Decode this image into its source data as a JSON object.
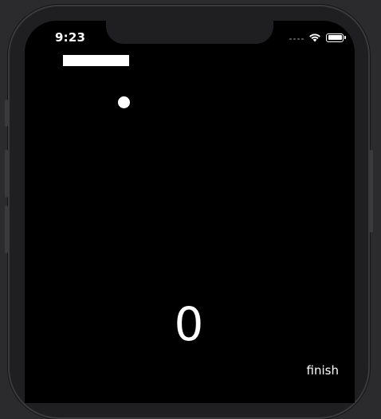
{
  "status_bar": {
    "time": "9:23",
    "icons": [
      "cellular-signal-icon",
      "wifi-icon",
      "battery-icon"
    ]
  },
  "game": {
    "score": "0",
    "finish_label": "finish"
  },
  "colors": {
    "background": "#000000",
    "foreground": "#ffffff",
    "device_frame": "#1f1f21"
  }
}
